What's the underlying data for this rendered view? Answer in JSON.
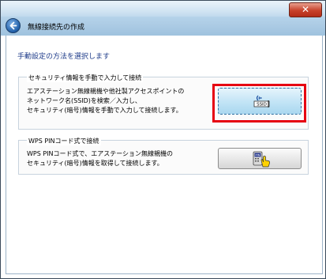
{
  "window": {
    "title": "無線接続先の作成",
    "close_glyph": "✕"
  },
  "instruction": "手動設定の方法を選択します",
  "options": [
    {
      "group_label": "セキュリティ情報を手動で入力して接続",
      "description_lines": [
        "エアステーション無線親機や他社製アクセスポイントの",
        "ネットワーク名(SSID)を検索／入力し、",
        "セキュリティ(暗号)情報を手動で入力して接続します。"
      ],
      "icon": "ssid-icon",
      "icon_text": "SSID",
      "highlighted": true
    },
    {
      "group_label": "WPS PINコード式で接続",
      "description_lines": [
        "WPS PINコード式で、エアステーション無線親機の",
        "セキュリティ(暗号)情報を取得して接続します。"
      ],
      "icon": "wps-pin-icon",
      "icon_text": "PIN",
      "highlighted": false
    }
  ],
  "colors": {
    "highlight": "#e60012",
    "instruction_text": "#1f3c8a"
  }
}
